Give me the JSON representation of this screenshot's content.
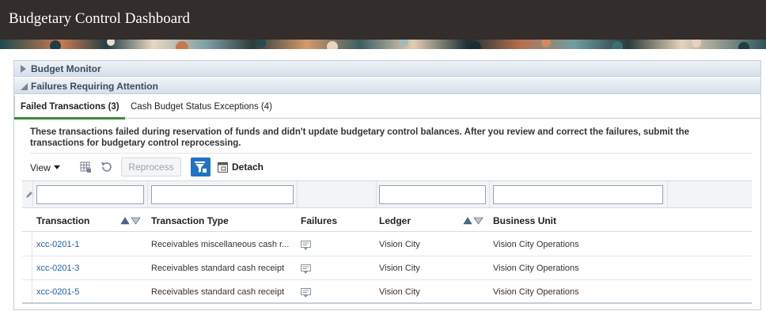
{
  "app": {
    "title": "Budgetary Control Dashboard"
  },
  "accordion": {
    "budget_monitor": "Budget Monitor",
    "failures": "Failures Requiring Attention"
  },
  "tabs": [
    {
      "label": "Failed Transactions (3)",
      "active": true
    },
    {
      "label": "Cash Budget Status Exceptions (4)",
      "active": false
    }
  ],
  "description": "These transactions failed during reservation of funds and didn't update budgetary control balances. After you review and correct the failures, submit the transactions for budgetary control reprocessing.",
  "toolbar": {
    "view_label": "View",
    "reprocess_label": "Reprocess",
    "detach_label": "Detach"
  },
  "table": {
    "columns": [
      "Transaction",
      "Transaction Type",
      "Failures",
      "Ledger",
      "Business Unit"
    ],
    "rows": [
      {
        "transaction": "xcc-0201-1",
        "type": "Receivables miscellaneous cash r...",
        "failures_icon": "failure-details-icon",
        "ledger": "Vision City",
        "business_unit": "Vision City Operations"
      },
      {
        "transaction": "xcc-0201-3",
        "type": "Receivables standard cash receipt",
        "failures_icon": "failure-details-icon",
        "ledger": "Vision City",
        "business_unit": "Vision City Operations"
      },
      {
        "transaction": "xcc-0201-5",
        "type": "Receivables standard cash receipt",
        "failures_icon": "failure-details-icon",
        "ledger": "Vision City",
        "business_unit": "Vision City Operations"
      }
    ]
  },
  "colors": {
    "title_bar": "#332d2b",
    "tab_active_underline": "#3d8a3a",
    "link": "#1f5fa5",
    "primary_button": "#1d73c7"
  }
}
